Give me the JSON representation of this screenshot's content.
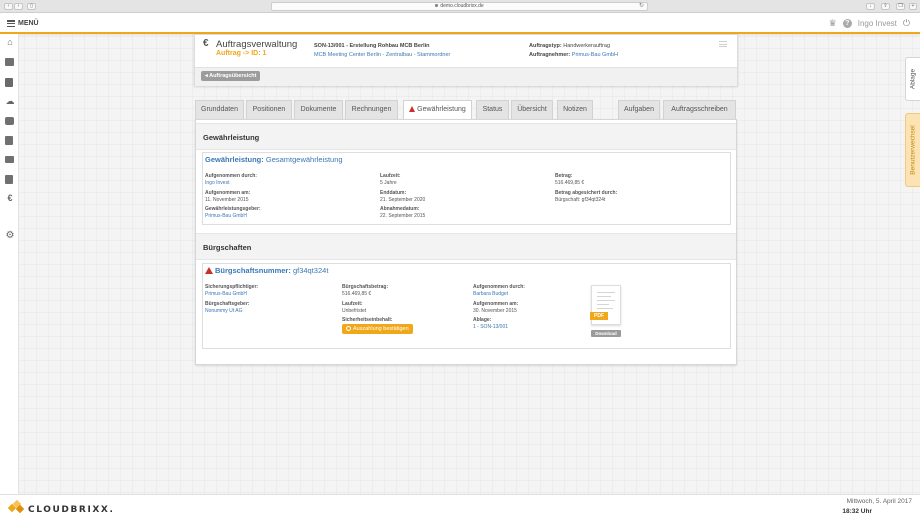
{
  "browser": {
    "url": "demo.cloudbrixx.de"
  },
  "header": {
    "menu_label": "MENÜ",
    "user_name": "Ingo Invest",
    "help_glyph": "?"
  },
  "order": {
    "title": "Auftragsverwaltung",
    "subtitle": "Auftrag -> ID: 1",
    "number_line": "SON-13/001 - Erstellung Rohbau MCB Berlin",
    "location_line": "MCB Meeting Center Berlin - Zentralbau - Stammordner",
    "type_label": "Auftragstyp:",
    "type_value": "Handwerkerauftrag",
    "contractor_label": "Auftragnehmer:",
    "contractor_value": "Primus-Bau GmbH",
    "back_label": "Auftragsübersicht"
  },
  "tabs": [
    {
      "label": "Grunddaten"
    },
    {
      "label": "Positionen"
    },
    {
      "label": "Dokumente"
    },
    {
      "label": "Rechnungen"
    },
    {
      "label": "Gewährleistung"
    },
    {
      "label": "Status"
    },
    {
      "label": "Übersicht"
    },
    {
      "label": "Notizen"
    },
    {
      "label": "Aufgaben"
    },
    {
      "label": "Auftragsschreiben"
    }
  ],
  "warranty": {
    "section_title": "Gewährleistung",
    "box_label": "Gewährleistung:",
    "box_value": "Gesamtgewährleistung",
    "fields": [
      {
        "label": "Aufgenommen durch:",
        "value": "Ingo Invest"
      },
      {
        "label": "Aufgenommen am:",
        "value": "11. November 2015"
      },
      {
        "label": "Gewährleistungsgeber:",
        "value": "Primus-Bau GmbH"
      },
      {
        "label": "Laufzeit:",
        "value": "5 Jahre"
      },
      {
        "label": "Enddatum:",
        "value": "21. September 2020"
      },
      {
        "label": "Abnahmedatum:",
        "value": "22. September 2015"
      },
      {
        "label": "Betrag:",
        "value": "516.469,85 €"
      },
      {
        "label": "Betrag abgesichert durch:",
        "value": "Bürgschaft: gf34qt324t"
      }
    ]
  },
  "guarantees": {
    "section_title": "Bürgschaften",
    "box_label": "Bürgschaftsnummer:",
    "box_value": "gf34qt324t",
    "fields": [
      {
        "label": "Sicherungspflichtiger:",
        "value": "Primus-Bau GmbH"
      },
      {
        "label": "Bürgschaftsgeber:",
        "value": "Nonummy Ut AG"
      },
      {
        "label": "Bürgschaftsbetrag:",
        "value": "516.469,85 €"
      },
      {
        "label": "Laufzeit:",
        "value": "Unbefristet"
      },
      {
        "label": "Sicherheitseinbehalt:",
        "value": ""
      },
      {
        "label": "Aufgenommen durch:",
        "value": "Barbara Budget"
      },
      {
        "label": "Aufgenommen am:",
        "value": "30. November 2015"
      },
      {
        "label": "Ablage:",
        "value": "1 - SON-13/001"
      }
    ],
    "confirm_label": "Auszahlung bestätigen",
    "pdf_label": "PDF",
    "download_label": "Download"
  },
  "side_tabs": {
    "storage": "Ablage",
    "user_switch": "Benutzerwechsel"
  },
  "footer": {
    "logo_text": "CLOUDBRIXX.",
    "date": "Mittwoch, 5. April 2017",
    "time": "18:32 Uhr"
  },
  "colors": {
    "accent": "#f0a81a",
    "link": "#3a78b5",
    "warning": "#c9302c"
  }
}
